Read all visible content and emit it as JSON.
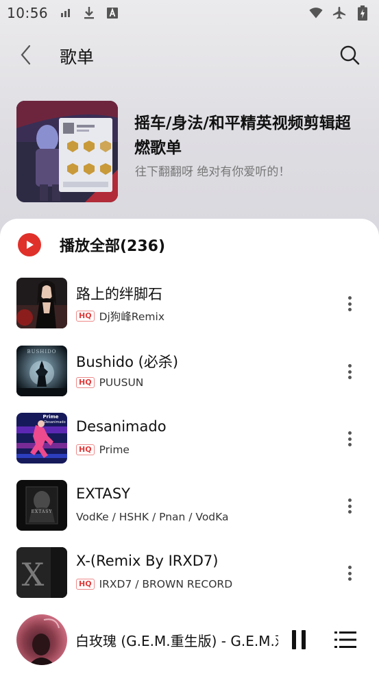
{
  "status_bar": {
    "time": "10:56",
    "left_icons": [
      "signal-bars-icon",
      "download-icon",
      "a-font-icon"
    ],
    "right_icons": [
      "wifi-icon",
      "airplane-icon",
      "battery-icon"
    ]
  },
  "header": {
    "title": "歌单",
    "back_icon": "chevron-left-icon",
    "search_icon": "search-icon"
  },
  "playlist": {
    "title": "摇车/身法/和平精英视频剪辑超燃歌单",
    "description": "往下翻翻呀 绝对有你爱听的！"
  },
  "play_all": {
    "label": "播放全部(236)",
    "icon": "play-circle-icon"
  },
  "songs": [
    {
      "title": "路上的绊脚石",
      "hq": "HQ",
      "artist": "Dj狗峰Remix"
    },
    {
      "title": "Bushido (必杀)",
      "hq": "HQ",
      "artist": "PUUSUN"
    },
    {
      "title": "Desanimado",
      "hq": "HQ",
      "artist": "Prime"
    },
    {
      "title": "EXTASY",
      "hq": "",
      "artist": "VodKe / HSHK / Pnan / VodKa"
    },
    {
      "title": "X-(Remix By IRXD7)",
      "hq": "HQ",
      "artist": "IRXD7 / BROWN RECORD"
    }
  ],
  "album_art_text": {
    "bushido": "BUSHIDO",
    "desanimado_top": "Prime",
    "desanimado_sub": "Desanimado",
    "extasy": "EXTASY",
    "x": "X"
  },
  "player": {
    "now_playing": "白玫瑰 (G.E.M.重生版) - G.E.M.邓紫棋",
    "pause_icon": "pause-icon",
    "queue_icon": "playlist-queue-icon"
  },
  "colors": {
    "accent": "#e0302a",
    "hq_badge": "#e03a3a",
    "sheet_bg": "#ffffff",
    "top_bg": "#e6e5e8"
  }
}
